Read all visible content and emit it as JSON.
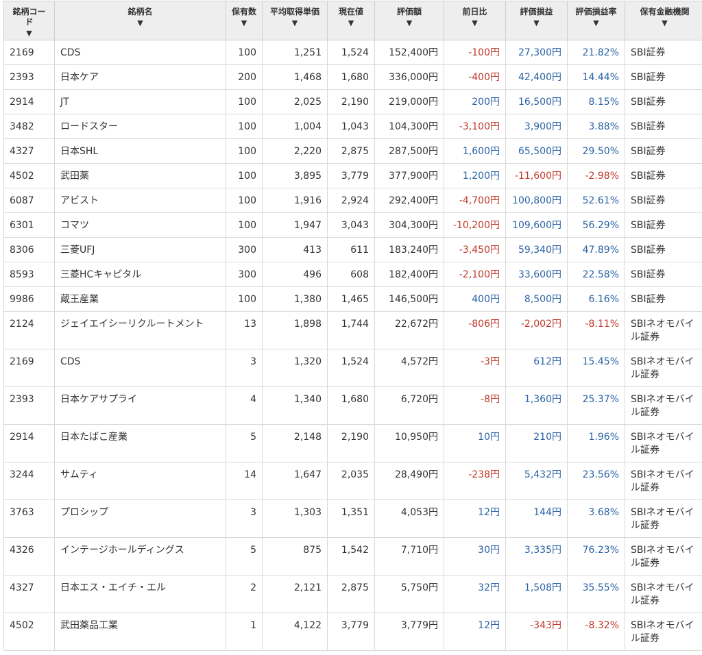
{
  "headers": [
    {
      "label": "銘柄コード"
    },
    {
      "label": "銘柄名"
    },
    {
      "label": "保有数"
    },
    {
      "label": "平均取得単価"
    },
    {
      "label": "現在値"
    },
    {
      "label": "評価額"
    },
    {
      "label": "前日比"
    },
    {
      "label": "評価損益"
    },
    {
      "label": "評価損益率"
    },
    {
      "label": "保有金融機関"
    }
  ],
  "sort_arrow": "▼",
  "colors": {
    "positive": "#2a63a6",
    "negative": "#c0392b",
    "header_bg": "#eeeeee"
  },
  "rows": [
    {
      "code": "2169",
      "name": "CDS",
      "qty": "100",
      "avg": "1,251",
      "price": "1,524",
      "value": "152,400円",
      "day": "-100円",
      "pl": "27,300円",
      "rate": "21.82%",
      "inst": "SBI証券"
    },
    {
      "code": "2393",
      "name": "日本ケア",
      "qty": "200",
      "avg": "1,468",
      "price": "1,680",
      "value": "336,000円",
      "day": "-400円",
      "pl": "42,400円",
      "rate": "14.44%",
      "inst": "SBI証券"
    },
    {
      "code": "2914",
      "name": "JT",
      "qty": "100",
      "avg": "2,025",
      "price": "2,190",
      "value": "219,000円",
      "day": "200円",
      "pl": "16,500円",
      "rate": "8.15%",
      "inst": "SBI証券"
    },
    {
      "code": "3482",
      "name": "ロードスター",
      "qty": "100",
      "avg": "1,004",
      "price": "1,043",
      "value": "104,300円",
      "day": "-3,100円",
      "pl": "3,900円",
      "rate": "3.88%",
      "inst": "SBI証券"
    },
    {
      "code": "4327",
      "name": "日本SHL",
      "qty": "100",
      "avg": "2,220",
      "price": "2,875",
      "value": "287,500円",
      "day": "1,600円",
      "pl": "65,500円",
      "rate": "29.50%",
      "inst": "SBI証券"
    },
    {
      "code": "4502",
      "name": "武田薬",
      "qty": "100",
      "avg": "3,895",
      "price": "3,779",
      "value": "377,900円",
      "day": "1,200円",
      "pl": "-11,600円",
      "rate": "-2.98%",
      "inst": "SBI証券"
    },
    {
      "code": "6087",
      "name": "アビスト",
      "qty": "100",
      "avg": "1,916",
      "price": "2,924",
      "value": "292,400円",
      "day": "-4,700円",
      "pl": "100,800円",
      "rate": "52.61%",
      "inst": "SBI証券"
    },
    {
      "code": "6301",
      "name": "コマツ",
      "qty": "100",
      "avg": "1,947",
      "price": "3,043",
      "value": "304,300円",
      "day": "-10,200円",
      "pl": "109,600円",
      "rate": "56.29%",
      "inst": "SBI証券"
    },
    {
      "code": "8306",
      "name": "三菱UFJ",
      "qty": "300",
      "avg": "413",
      "price": "611",
      "value": "183,240円",
      "day": "-3,450円",
      "pl": "59,340円",
      "rate": "47.89%",
      "inst": "SBI証券"
    },
    {
      "code": "8593",
      "name": "三菱HCキャピタル",
      "qty": "300",
      "avg": "496",
      "price": "608",
      "value": "182,400円",
      "day": "-2,100円",
      "pl": "33,600円",
      "rate": "22.58%",
      "inst": "SBI証券"
    },
    {
      "code": "9986",
      "name": "蔵王産業",
      "qty": "100",
      "avg": "1,380",
      "price": "1,465",
      "value": "146,500円",
      "day": "400円",
      "pl": "8,500円",
      "rate": "6.16%",
      "inst": "SBI証券"
    },
    {
      "code": "2124",
      "name": "ジェイエイシーリクルートメント",
      "qty": "13",
      "avg": "1,898",
      "price": "1,744",
      "value": "22,672円",
      "day": "-806円",
      "pl": "-2,002円",
      "rate": "-8.11%",
      "inst": "SBIネオモバイル証券"
    },
    {
      "code": "2169",
      "name": "CDS",
      "qty": "3",
      "avg": "1,320",
      "price": "1,524",
      "value": "4,572円",
      "day": "-3円",
      "pl": "612円",
      "rate": "15.45%",
      "inst": "SBIネオモバイル証券"
    },
    {
      "code": "2393",
      "name": "日本ケアサプライ",
      "qty": "4",
      "avg": "1,340",
      "price": "1,680",
      "value": "6,720円",
      "day": "-8円",
      "pl": "1,360円",
      "rate": "25.37%",
      "inst": "SBIネオモバイル証券"
    },
    {
      "code": "2914",
      "name": "日本たばこ産業",
      "qty": "5",
      "avg": "2,148",
      "price": "2,190",
      "value": "10,950円",
      "day": "10円",
      "pl": "210円",
      "rate": "1.96%",
      "inst": "SBIネオモバイル証券"
    },
    {
      "code": "3244",
      "name": "サムティ",
      "qty": "14",
      "avg": "1,647",
      "price": "2,035",
      "value": "28,490円",
      "day": "-238円",
      "pl": "5,432円",
      "rate": "23.56%",
      "inst": "SBIネオモバイル証券"
    },
    {
      "code": "3763",
      "name": "プロシップ",
      "qty": "3",
      "avg": "1,303",
      "price": "1,351",
      "value": "4,053円",
      "day": "12円",
      "pl": "144円",
      "rate": "3.68%",
      "inst": "SBIネオモバイル証券"
    },
    {
      "code": "4326",
      "name": "インテージホールディングス",
      "qty": "5",
      "avg": "875",
      "price": "1,542",
      "value": "7,710円",
      "day": "30円",
      "pl": "3,335円",
      "rate": "76.23%",
      "inst": "SBIネオモバイル証券"
    },
    {
      "code": "4327",
      "name": "日本エス・エイチ・エル",
      "qty": "2",
      "avg": "2,121",
      "price": "2,875",
      "value": "5,750円",
      "day": "32円",
      "pl": "1,508円",
      "rate": "35.55%",
      "inst": "SBIネオモバイル証券"
    },
    {
      "code": "4502",
      "name": "武田薬品工業",
      "qty": "1",
      "avg": "4,122",
      "price": "3,779",
      "value": "3,779円",
      "day": "12円",
      "pl": "-343円",
      "rate": "-8.32%",
      "inst": "SBIネオモバイル証券"
    }
  ]
}
